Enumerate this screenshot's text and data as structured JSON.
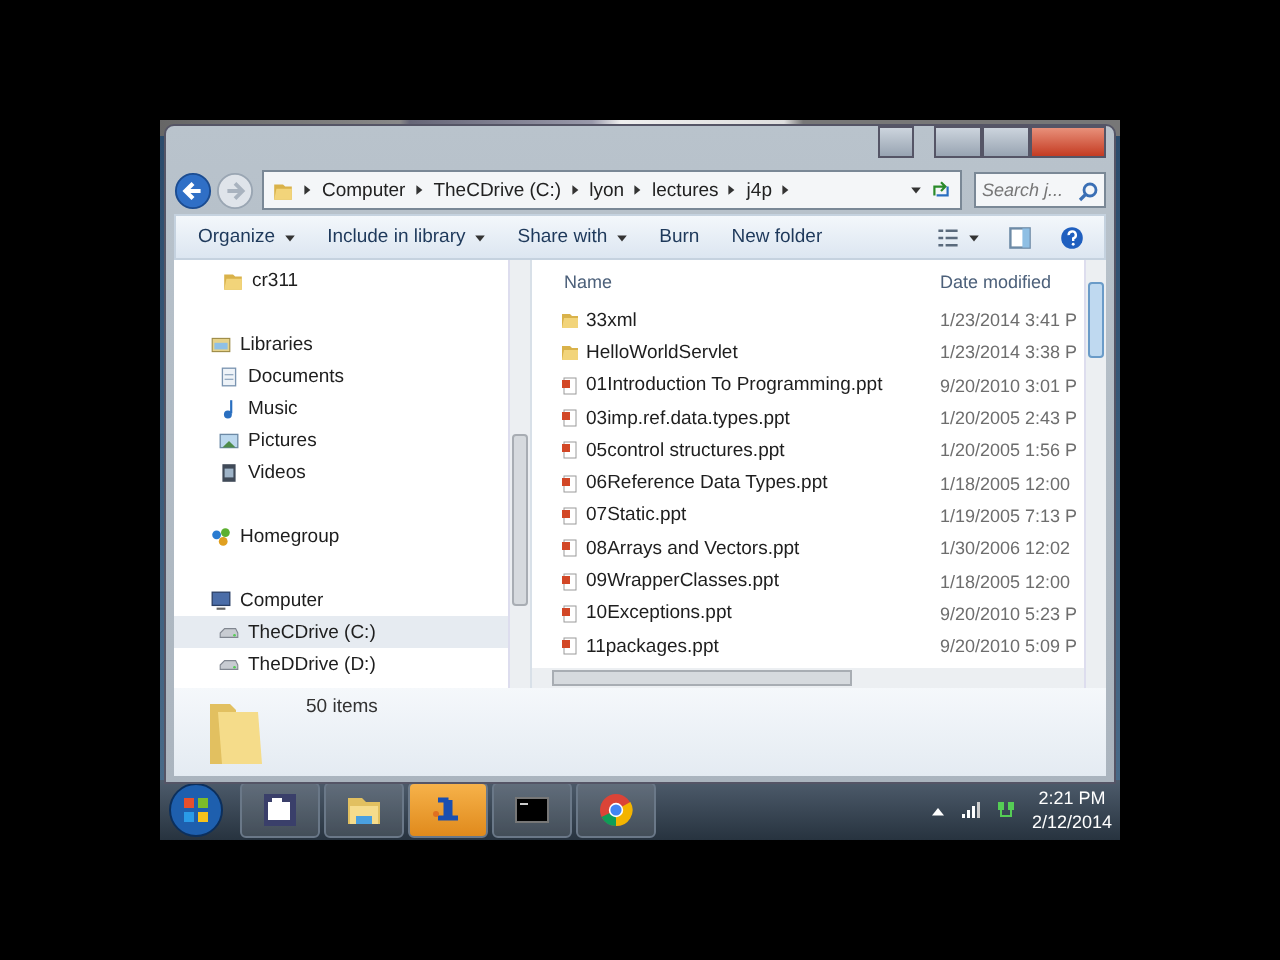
{
  "address": {
    "path": [
      "Computer",
      "TheCDrive (C:)",
      "lyon",
      "lectures",
      "j4p"
    ]
  },
  "search": {
    "placeholder": "Search j..."
  },
  "toolbar": [
    {
      "label": "Organize",
      "dropdown": true
    },
    {
      "label": "Include in library",
      "dropdown": true
    },
    {
      "label": "Share with",
      "dropdown": true
    },
    {
      "label": "Burn",
      "dropdown": false
    },
    {
      "label": "New folder",
      "dropdown": false
    }
  ],
  "sidebar": {
    "items": [
      {
        "label": "cr311",
        "kind": "folder",
        "selected": false
      },
      {
        "label": "Libraries",
        "kind": "libraries",
        "selected": false,
        "children": [
          {
            "label": "Documents",
            "kind": "documents",
            "selected": false
          },
          {
            "label": "Music",
            "kind": "music",
            "selected": false
          },
          {
            "label": "Pictures",
            "kind": "pictures",
            "selected": false
          },
          {
            "label": "Videos",
            "kind": "videos",
            "selected": false
          }
        ]
      },
      {
        "label": "Homegroup",
        "kind": "homegroup",
        "selected": false
      },
      {
        "label": "Computer",
        "kind": "computer",
        "selected": false,
        "children": [
          {
            "label": "TheCDrive (C:)",
            "kind": "drive",
            "selected": true
          },
          {
            "label": "TheDDrive (D:)",
            "kind": "drive",
            "selected": false
          }
        ]
      }
    ]
  },
  "table": {
    "columns": [
      "Name",
      "Date modified"
    ],
    "rows": [
      {
        "kind": "folder",
        "name": "33xml",
        "date": "1/23/2014 3:41 P"
      },
      {
        "kind": "folder",
        "name": "HelloWorldServlet",
        "date": "1/23/2014 3:38 P"
      },
      {
        "kind": "ppt",
        "name": "01Introduction To Programming.ppt",
        "date": "9/20/2010 3:01 P"
      },
      {
        "kind": "ppt",
        "name": "03imp.ref.data.types.ppt",
        "date": "1/20/2005 2:43 P"
      },
      {
        "kind": "ppt",
        "name": "05control structures.ppt",
        "date": "1/20/2005 1:56 P"
      },
      {
        "kind": "ppt",
        "name": "06Reference Data Types.ppt",
        "date": "1/18/2005 12:00"
      },
      {
        "kind": "ppt",
        "name": "07Static.ppt",
        "date": "1/19/2005 7:13 P"
      },
      {
        "kind": "ppt",
        "name": "08Arrays and Vectors.ppt",
        "date": "1/30/2006 12:02"
      },
      {
        "kind": "ppt",
        "name": "09WrapperClasses.ppt",
        "date": "1/18/2005 12:00"
      },
      {
        "kind": "ppt",
        "name": "10Exceptions.ppt",
        "date": "9/20/2010 5:23 P"
      },
      {
        "kind": "ppt",
        "name": "11packages.ppt",
        "date": "9/20/2010 5:09 P"
      }
    ]
  },
  "status_bar": {
    "text": "50 items"
  },
  "taskbar": {
    "apps": [
      {
        "kind": "media",
        "selected": false
      },
      {
        "kind": "explorer",
        "selected": false
      },
      {
        "kind": "ide",
        "selected": true
      },
      {
        "kind": "console",
        "selected": false
      },
      {
        "kind": "browser",
        "selected": false
      }
    ],
    "time": "2:21 PM",
    "date": "2/12/2014"
  }
}
